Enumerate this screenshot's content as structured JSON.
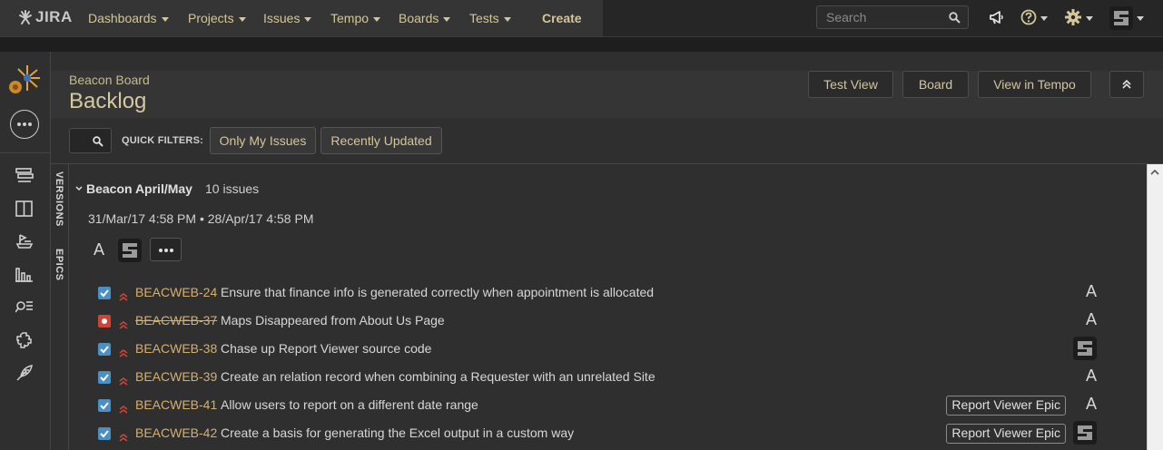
{
  "topnav": {
    "logo_text": "JIRA",
    "items": [
      {
        "label": "Dashboards"
      },
      {
        "label": "Projects"
      },
      {
        "label": "Issues"
      },
      {
        "label": "Tempo"
      },
      {
        "label": "Boards"
      },
      {
        "label": "Tests"
      }
    ],
    "create_label": "Create",
    "search_placeholder": "Search"
  },
  "header": {
    "breadcrumb": "Beacon Board",
    "title": "Backlog",
    "buttons": [
      "Test View",
      "Board",
      "View in Tempo"
    ]
  },
  "filters": {
    "label": "QUICK FILTERS:",
    "buttons": [
      "Only My Issues",
      "Recently Updated"
    ]
  },
  "side_tabs": [
    "VERSIONS",
    "EPICS"
  ],
  "sprint": {
    "name": "Beacon April/May",
    "count": "10 issues",
    "start": "31/Mar/17 4:58 PM",
    "separator": "•",
    "end": "28/Apr/17 4:58 PM",
    "assignee_letter": "A"
  },
  "issues": [
    {
      "key": "BEACWEB-24",
      "summary": "Ensure that finance info is generated correctly when appointment is allocated",
      "type": "task",
      "done": false,
      "epic": "",
      "assignee": "A"
    },
    {
      "key": "BEACWEB-37",
      "summary": "Maps Disappeared from About Us Page",
      "type": "bug",
      "done": true,
      "epic": "",
      "assignee": "A"
    },
    {
      "key": "BEACWEB-38",
      "summary": "Chase up Report Viewer source code",
      "type": "task",
      "done": false,
      "epic": "",
      "assignee": "avatar"
    },
    {
      "key": "BEACWEB-39",
      "summary": "Create an relation record when combining a Requester with an unrelated Site",
      "type": "task",
      "done": false,
      "epic": "",
      "assignee": "A"
    },
    {
      "key": "BEACWEB-41",
      "summary": "Allow users to report on a different date range",
      "type": "task",
      "done": false,
      "epic": "Report Viewer Epic",
      "assignee": "A"
    },
    {
      "key": "BEACWEB-42",
      "summary": "Create a basis for generating the Excel output in a custom way",
      "type": "task",
      "done": false,
      "epic": "Report Viewer Epic",
      "assignee": "avatar"
    }
  ],
  "colors": {
    "accent": "#d4c59a",
    "issue_key": "#d4b070",
    "task": "#4a90c4",
    "bug": "#d04437",
    "priority": "#d04437"
  }
}
